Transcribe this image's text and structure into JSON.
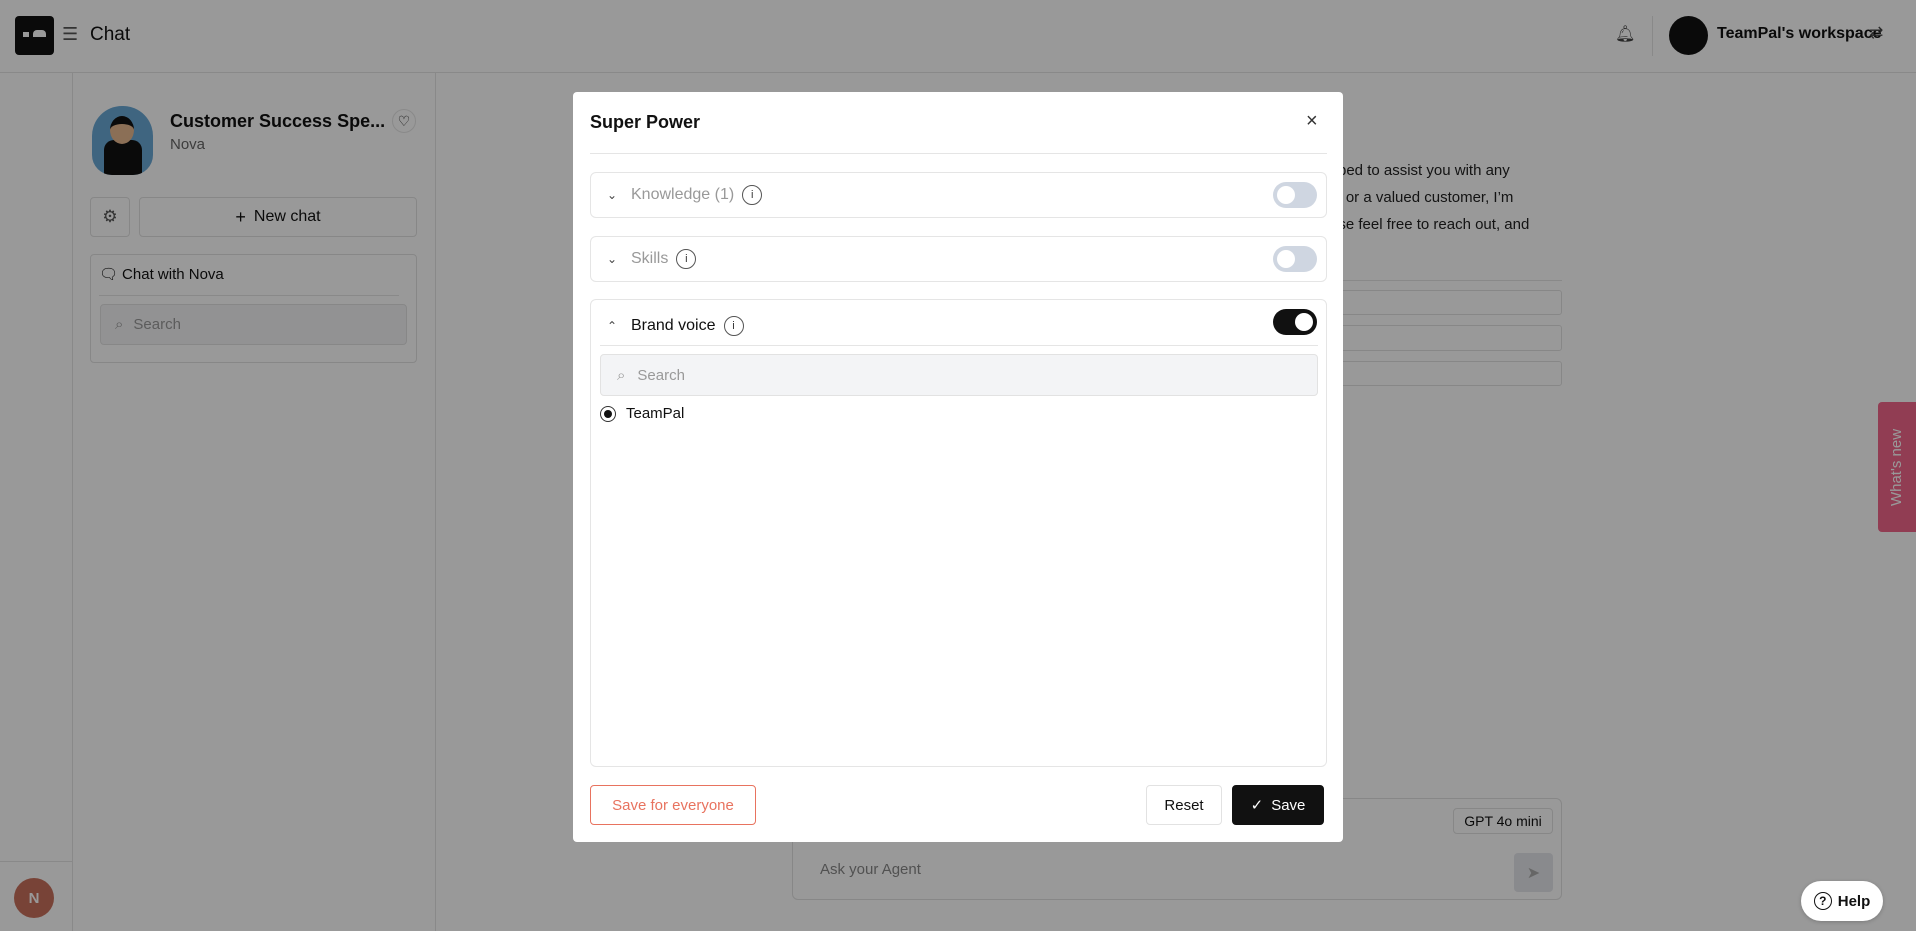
{
  "header": {
    "title": "Chat",
    "workspace": "TeamPal's workspace"
  },
  "sidebar": {
    "agent_title": "Customer Success Spe...",
    "agent_name": "Nova",
    "new_chat": "New chat",
    "chat_with": "Chat with Nova",
    "search_placeholder": "Search"
  },
  "user": {
    "initial": "N"
  },
  "chat": {
    "lines": [
      "ped to assist you with any",
      "ie or a valued customer, I’m",
      "ase feel free to reach out, and"
    ],
    "input_placeholder": "Ask your Agent",
    "model": "GPT 4o mini"
  },
  "whats_new": "What's new",
  "help": "Help",
  "modal": {
    "title": "Super Power",
    "sections": [
      {
        "label": "Knowledge (1)",
        "enabled": false,
        "expanded": false
      },
      {
        "label": "Skills",
        "enabled": false,
        "expanded": false
      },
      {
        "label": "Brand voice",
        "enabled": true,
        "expanded": true
      }
    ],
    "brand_search_placeholder": "Search",
    "brand_options": [
      {
        "label": "TeamPal",
        "selected": true
      }
    ],
    "save_everyone": "Save for everyone",
    "reset": "Reset",
    "save": "Save"
  },
  "colors": {
    "accent_danger": "#e8735f",
    "whats_new": "#f2668b",
    "primary": "#111111"
  }
}
